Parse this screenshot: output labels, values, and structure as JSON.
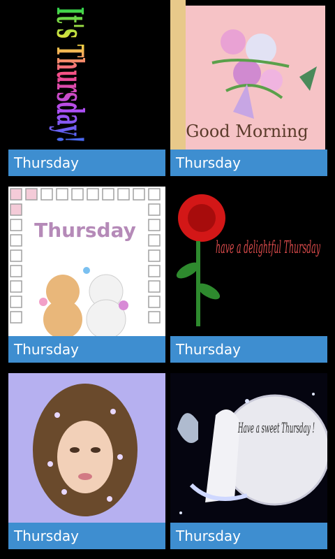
{
  "cards": [
    {
      "caption": "Thursday",
      "image_text": "It's Thursday!"
    },
    {
      "caption": "Thursday",
      "image_text": "Good Morning"
    },
    {
      "caption": "Thursday",
      "image_text": "Thursday"
    },
    {
      "caption": "Thursday",
      "image_text": "have a delightful Thursday"
    },
    {
      "caption": "Thursday",
      "image_text": ""
    },
    {
      "caption": "Thursday",
      "image_text": "Have a sweet Thursday !"
    }
  ],
  "colors": {
    "caption_bg": "#3e8ed0",
    "caption_text": "#ffffff",
    "background": "#000000"
  }
}
